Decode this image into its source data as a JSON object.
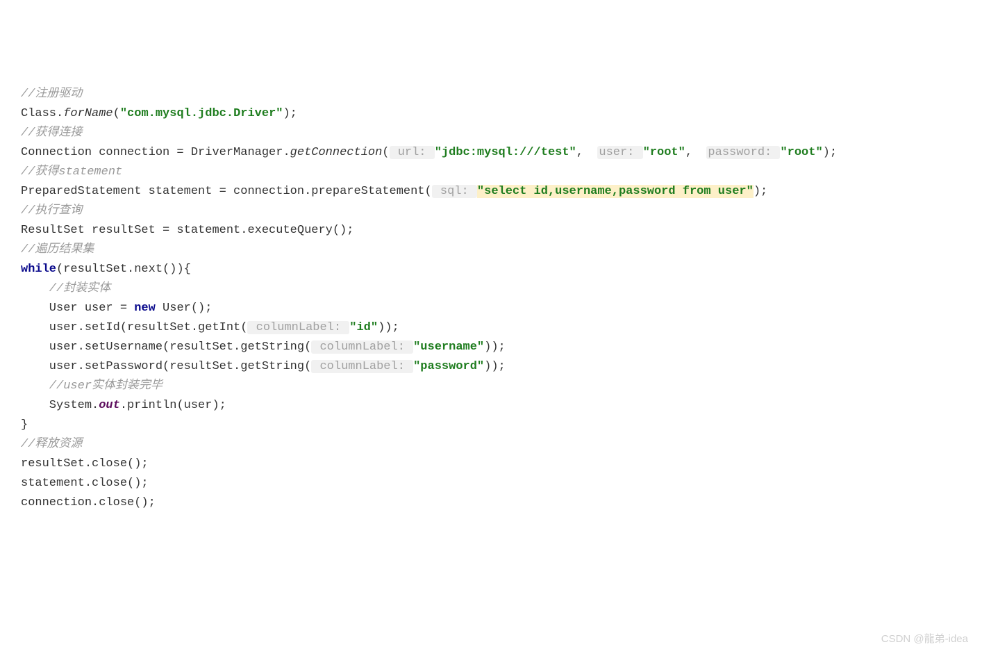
{
  "code": {
    "c1": "//注册驱动",
    "l2a": "Class.",
    "l2b": "forName",
    "l2c": "(",
    "l2d": "\"com.mysql.jdbc.Driver\"",
    "l2e": ");",
    "c3": "//获得连接",
    "l4a": "Connection connection = DriverManager.",
    "l4b": "getConnection",
    "l4c": "(",
    "l4h1": " url: ",
    "l4s1": "\"jdbc:mysql:///test\"",
    "l4p1": ",  ",
    "l4h2": "user: ",
    "l4s2": "\"root\"",
    "l4p2": ",  ",
    "l4h3": "password: ",
    "l4s3": "\"root\"",
    "l4e": ");",
    "c5": "//获得statement",
    "l6a": "PreparedStatement statement = connection.prepareStatement(",
    "l6h": " sql: ",
    "l6q1": "\"",
    "l6sel": "select",
    "l6mid": " id,username,password ",
    "l6from": "from",
    "l6usr": " user",
    "l6q2": "\"",
    "l6e": ");",
    "c7": "//执行查询",
    "l8": "ResultSet resultSet = statement.executeQuery();",
    "c9": "//遍历结果集",
    "l10a": "while",
    "l10b": "(resultSet.next()){",
    "c11": "    //封装实体",
    "l12a": "    User user = ",
    "l12b": "new",
    "l12c": " User();",
    "l13a": "    user.setId(resultSet.getInt(",
    "l13h": " columnLabel: ",
    "l13s": "\"id\"",
    "l13e": "));",
    "l14a": "    user.setUsername(resultSet.getString(",
    "l14h": " columnLabel: ",
    "l14s": "\"username\"",
    "l14e": "));",
    "l15a": "    user.setPassword(resultSet.getString(",
    "l15h": " columnLabel: ",
    "l15s": "\"password\"",
    "l15e": "));",
    "c16": "    //user实体封装完毕",
    "l17a": "    System.",
    "l17b": "out",
    "l17c": ".println(user);",
    "l18": "}",
    "c19": "//释放资源",
    "l20": "resultSet.close();",
    "l21": "statement.close();",
    "l22": "connection.close();"
  },
  "watermark": "CSDN @龍弟-idea"
}
